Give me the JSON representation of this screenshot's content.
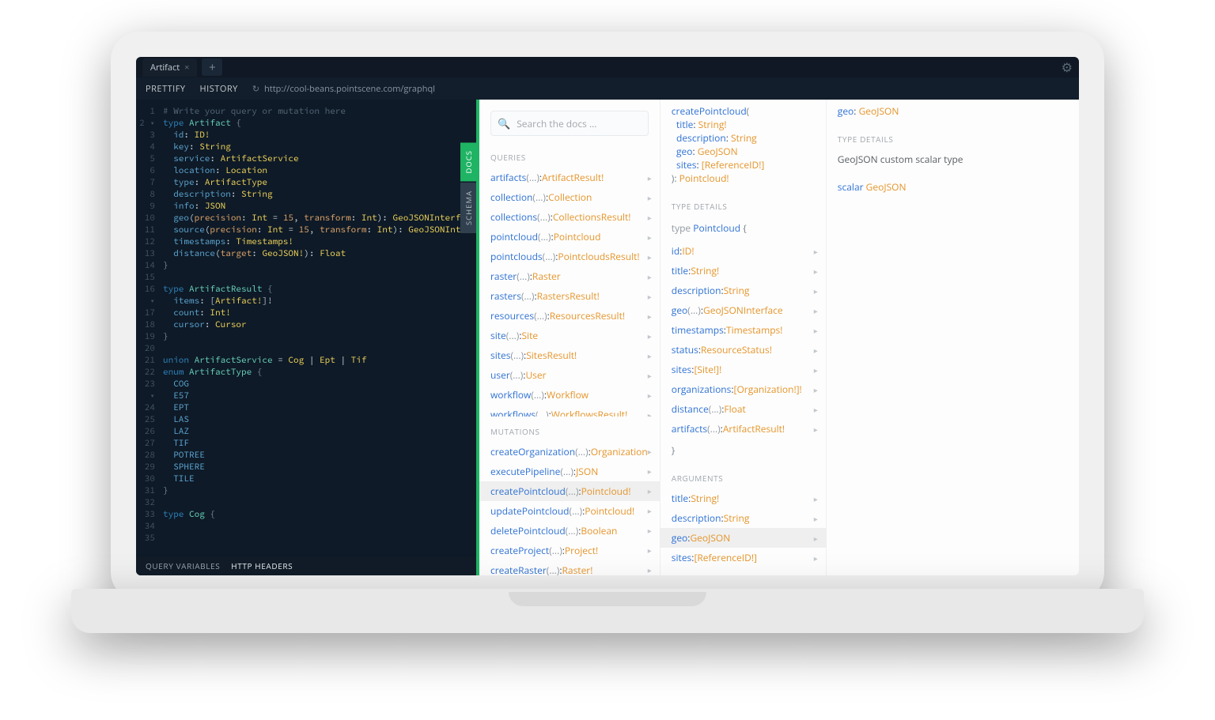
{
  "titlebar": {
    "tab": "Artifact",
    "close": "×",
    "plus": "+",
    "settings_title": "Settings"
  },
  "toolbar": {
    "prettify": "PRETTIFY",
    "history": "HISTORY",
    "reload": "↻",
    "url": "http://cool-beans.pointscene.com/graphql"
  },
  "editor": {
    "lines": [
      {
        "n": "1",
        "html": "<span class='cmt'># Write your query or mutation here</span>"
      },
      {
        "n": "2 ▾",
        "html": "<span class='kw'>type</span> <span class='name'>Artifact</span> <span class='punct'>{</span>"
      },
      {
        "n": "3",
        "html": "  <span class='fld'>id</span>: <span class='typ'>ID!</span>"
      },
      {
        "n": "4",
        "html": "  <span class='fld'>key</span>: <span class='typ'>String</span>"
      },
      {
        "n": "5",
        "html": "  <span class='fld'>service</span>: <span class='typ'>ArtifactService</span>"
      },
      {
        "n": "6",
        "html": "  <span class='fld'>location</span>: <span class='typ'>Location</span>"
      },
      {
        "n": "7",
        "html": "  <span class='fld'>type</span>: <span class='typ'>ArtifactType</span>"
      },
      {
        "n": "8",
        "html": "  <span class='fld'>description</span>: <span class='typ'>String</span>"
      },
      {
        "n": "9",
        "html": "  <span class='fld'>info</span>: <span class='typ'>JSON</span>"
      },
      {
        "n": "10",
        "html": "  <span class='fld'>geo</span>(<span class='int'>precision</span>: <span class='typ'>Int</span> = <span class='int'>15</span>, <span class='int'>transform</span>: <span class='typ'>Int</span>): <span class='typ'>GeoJSONInterfac</span>"
      },
      {
        "n": "11",
        "html": "  <span class='fld'>source</span>(<span class='int'>precision</span>: <span class='typ'>Int</span> = <span class='int'>15</span>, <span class='int'>transform</span>: <span class='typ'>Int</span>): <span class='typ'>GeoJSONInter</span>"
      },
      {
        "n": "12",
        "html": "  <span class='fld'>timestamps</span>: <span class='typ'>Timestamps!</span>"
      },
      {
        "n": "13",
        "html": "  <span class='fld'>distance</span>(<span class='int'>target</span>: <span class='typ'>GeoJSON!</span>): <span class='typ'>Float</span>"
      },
      {
        "n": "14",
        "html": "<span class='punct'>}</span>"
      },
      {
        "n": "15",
        "html": ""
      },
      {
        "n": "16 ▾",
        "html": "<span class='kw'>type</span> <span class='name'>ArtifactResult</span> <span class='punct'>{</span>"
      },
      {
        "n": "17",
        "html": "  <span class='fld'>items</span>: [<span class='typ'>Artifact!</span>]!"
      },
      {
        "n": "18",
        "html": "  <span class='fld'>count</span>: <span class='typ'>Int!</span>"
      },
      {
        "n": "19",
        "html": "  <span class='fld'>cursor</span>: <span class='typ'>Cursor</span>"
      },
      {
        "n": "20",
        "html": "<span class='punct'>}</span>"
      },
      {
        "n": "21",
        "html": ""
      },
      {
        "n": "22",
        "html": "<span class='kw'>union</span> <span class='name'>ArtifactService</span> = <span class='typ'>Cog</span> | <span class='typ'>Ept</span> | <span class='typ'>Tif</span>"
      },
      {
        "n": "23 ▾",
        "html": "<span class='kw'>enum</span> <span class='name'>ArtifactType</span> <span class='punct'>{</span>"
      },
      {
        "n": "24",
        "html": "  <span class='fld'>COG</span>"
      },
      {
        "n": "25",
        "html": "  <span class='fld'>E57</span>"
      },
      {
        "n": "26",
        "html": "  <span class='fld'>EPT</span>"
      },
      {
        "n": "27",
        "html": "  <span class='fld'>LAS</span>"
      },
      {
        "n": "28",
        "html": "  <span class='fld'>LAZ</span>"
      },
      {
        "n": "29",
        "html": "  <span class='fld'>TIF</span>"
      },
      {
        "n": "30",
        "html": "  <span class='fld'>POTREE</span>"
      },
      {
        "n": "31",
        "html": "  <span class='fld'>SPHERE</span>"
      },
      {
        "n": "32",
        "html": "  <span class='fld'>TILE</span>"
      },
      {
        "n": "33",
        "html": "<span class='punct'>}</span>"
      },
      {
        "n": "34",
        "html": ""
      },
      {
        "n": "35",
        "html": "<span class='kw'>type</span> <span class='name'>Cog</span> <span class='punct'>{</span>"
      }
    ],
    "footer": {
      "qv": "QUERY VARIABLES",
      "hh": "HTTP HEADERS"
    }
  },
  "docs": {
    "side_docs": "DOCS",
    "side_schema": "SCHEMA",
    "search_placeholder": "Search the docs ...",
    "queries_label": "QUERIES",
    "mutations_label": "MUTATIONS",
    "type_details_label": "TYPE DETAILS",
    "arguments_label": "ARGUMENTS",
    "queries": [
      {
        "name": "artifacts",
        "args": "(...)",
        "ret": "ArtifactResult!"
      },
      {
        "name": "collection",
        "args": "(...)",
        "ret": "Collection"
      },
      {
        "name": "collections",
        "args": "(...)",
        "ret": "CollectionsResult!"
      },
      {
        "name": "pointcloud",
        "args": "(...)",
        "ret": "Pointcloud"
      },
      {
        "name": "pointclouds",
        "args": "(...)",
        "ret": "PointcloudsResult!"
      },
      {
        "name": "raster",
        "args": "(...)",
        "ret": "Raster"
      },
      {
        "name": "rasters",
        "args": "(...)",
        "ret": "RastersResult!"
      },
      {
        "name": "resources",
        "args": "(...)",
        "ret": "ResourcesResult!"
      },
      {
        "name": "site",
        "args": "(...)",
        "ret": "Site"
      },
      {
        "name": "sites",
        "args": "(...)",
        "ret": "SitesResult!"
      },
      {
        "name": "user",
        "args": "(...)",
        "ret": "User"
      },
      {
        "name": "workflow",
        "args": "(...)",
        "ret": "Workflow"
      },
      {
        "name": "workflows",
        "args": "(...)",
        "ret": "WorkflowsResult!"
      }
    ],
    "mutations": [
      {
        "name": "createOrganization",
        "args": "(...)",
        "ret": "Organization"
      },
      {
        "name": "executePipeline",
        "args": "(...)",
        "ret": "JSON"
      },
      {
        "name": "createPointcloud",
        "args": "(...)",
        "ret": "Pointcloud!",
        "selected": true
      },
      {
        "name": "updatePointcloud",
        "args": "(...)",
        "ret": "Pointcloud!"
      },
      {
        "name": "deletePointcloud",
        "args": "(...)",
        "ret": "Boolean"
      },
      {
        "name": "createProject",
        "args": "(...)",
        "ret": "Project!"
      },
      {
        "name": "createRaster",
        "args": "(...)",
        "ret": "Raster!"
      }
    ]
  },
  "panel2": {
    "signature": {
      "name": "createPointcloud",
      "params": [
        {
          "k": "title",
          "t": "String!"
        },
        {
          "k": "description",
          "t": "String"
        },
        {
          "k": "geo",
          "t": "GeoJSON"
        },
        {
          "k": "sites",
          "t": "[ReferenceID!]"
        }
      ],
      "ret": "Pointcloud!"
    },
    "type_decl": {
      "kw": "type",
      "name": "Pointcloud"
    },
    "fields": [
      {
        "k": "id",
        "t": "ID!"
      },
      {
        "k": "title",
        "t": "String!"
      },
      {
        "k": "description",
        "t": "String"
      },
      {
        "k": "geo",
        "args": "(...)",
        "t": "GeoJSONInterface"
      },
      {
        "k": "timestamps",
        "t": "Timestamps!"
      },
      {
        "k": "status",
        "t": "ResourceStatus!"
      },
      {
        "k": "sites",
        "t": "[Site!]!"
      },
      {
        "k": "organizations",
        "t": "[Organization!]!"
      },
      {
        "k": "distance",
        "args": "(...)",
        "t": "Float"
      },
      {
        "k": "artifacts",
        "args": "(...)",
        "t": "ArtifactResult!"
      }
    ],
    "close_brace": "}",
    "arguments": [
      {
        "k": "title",
        "t": "String!"
      },
      {
        "k": "description",
        "t": "String"
      },
      {
        "k": "geo",
        "t": "GeoJSON",
        "selected": true
      },
      {
        "k": "sites",
        "t": "[ReferenceID!]"
      }
    ]
  },
  "panel3": {
    "header": {
      "k": "geo",
      "t": "GeoJSON"
    },
    "type_details_text": "GeoJSON custom scalar type",
    "scalar": {
      "kw": "scalar",
      "name": "GeoJSON"
    }
  }
}
